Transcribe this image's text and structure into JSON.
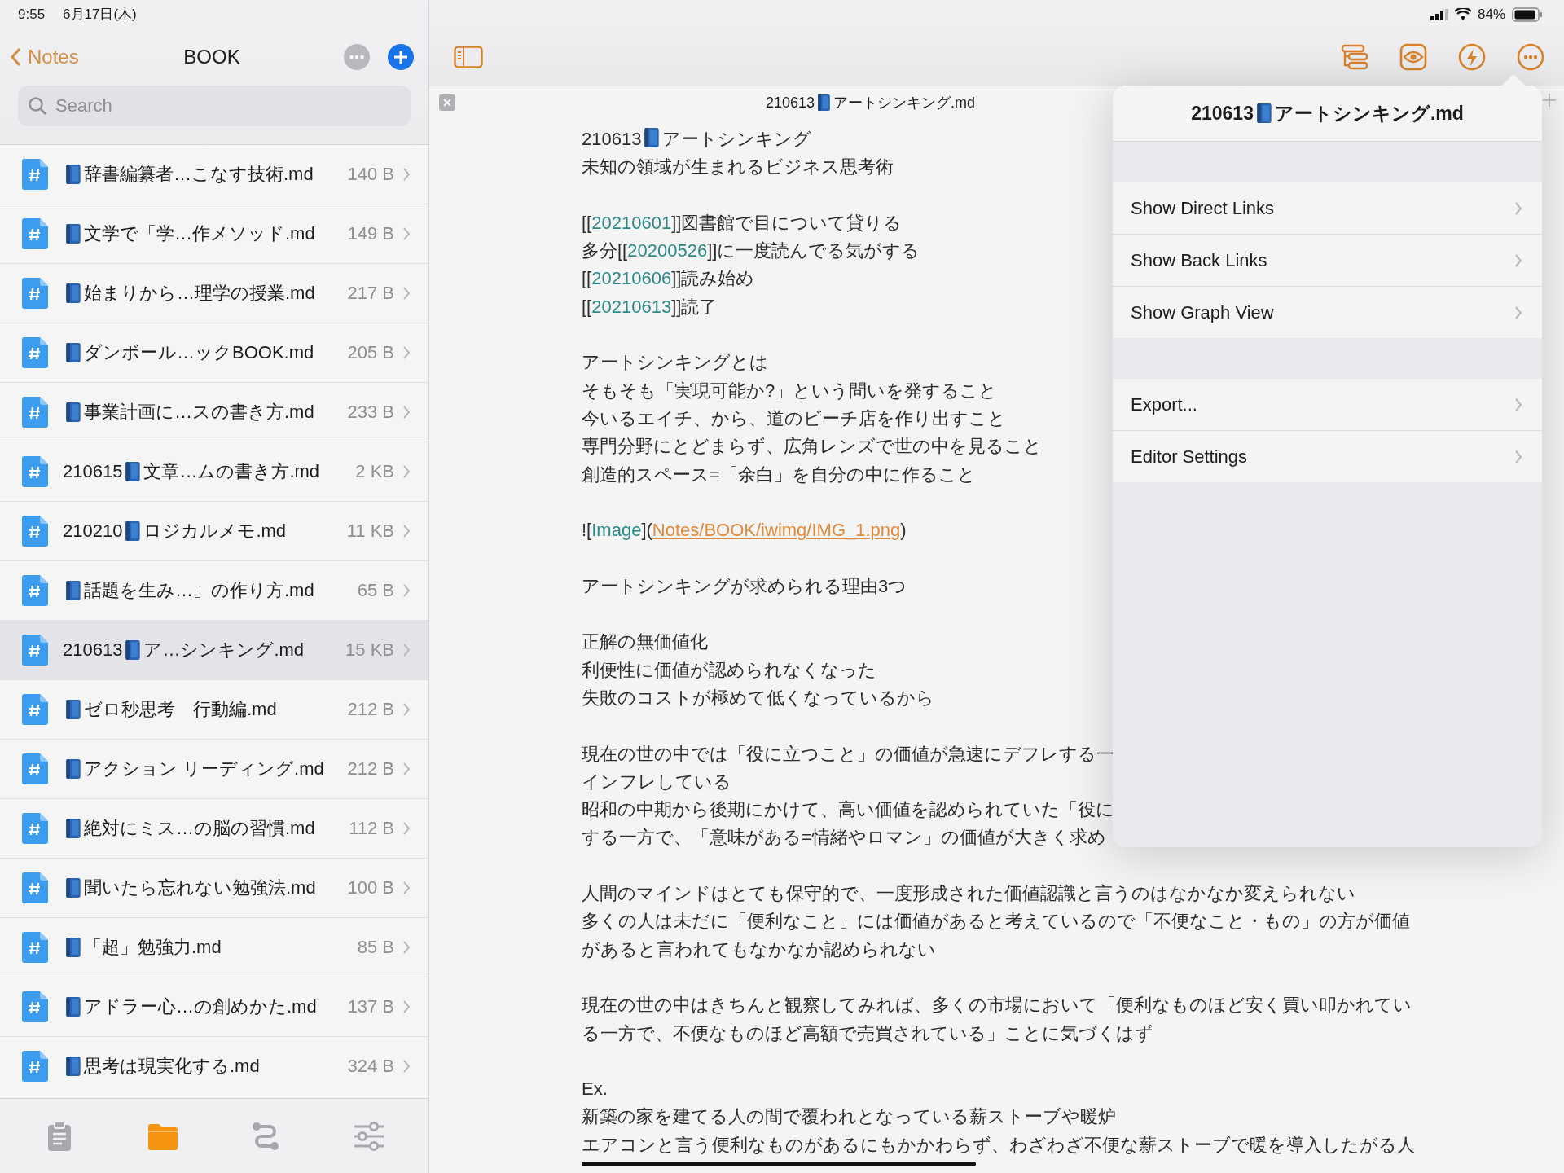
{
  "status_bar": {
    "time": "9:55",
    "date": "6月17日(木)",
    "battery": "84%"
  },
  "sidebar": {
    "back": "Notes",
    "title": "BOOK",
    "search": {
      "placeholder": "Search"
    },
    "files": [
      {
        "title": "辞書編纂者…こなす技術.md",
        "size": "140 B",
        "selected": false
      },
      {
        "title": "文学で「学…作メソッド.md",
        "size": "149 B",
        "selected": false
      },
      {
        "title": "始まりから…理学の授業.md",
        "size": "217 B",
        "selected": false
      },
      {
        "title": "ダンボール…ックBOOK.md",
        "size": "205 B",
        "selected": false
      },
      {
        "title": "事業計画に…スの書き方.md",
        "size": "233 B",
        "selected": false
      },
      {
        "date": "210615",
        "title": "文章…ムの書き方.md",
        "size": "2 KB",
        "selected": false
      },
      {
        "date": "210210",
        "title": "ロジカルメモ.md",
        "size": "11 KB",
        "selected": false
      },
      {
        "title": "話題を生み…」の作り方.md",
        "size": "65 B",
        "selected": false
      },
      {
        "date": "210613",
        "title": "ア…シンキング.md",
        "size": "15 KB",
        "selected": true
      },
      {
        "title": "ゼロ秒思考　行動編.md",
        "size": "212 B",
        "selected": false
      },
      {
        "title": "アクション リーディング.md",
        "size": "212 B",
        "selected": false
      },
      {
        "title": "絶対にミス…の脳の習慣.md",
        "size": "112 B",
        "selected": false
      },
      {
        "title": "聞いたら忘れない勉強法.md",
        "size": "100 B",
        "selected": false
      },
      {
        "title": "「超」勉強力.md",
        "size": "85 B",
        "selected": false
      },
      {
        "title": "アドラー心…の創めかた.md",
        "size": "137 B",
        "selected": false
      },
      {
        "title": "思考は現実化する.md",
        "size": "324 B",
        "selected": false
      }
    ]
  },
  "tab_bar": [
    {
      "selected": false
    },
    {
      "selected": true
    },
    {
      "selected": false
    },
    {
      "selected": false
    }
  ],
  "editor": {
    "file_tab": {
      "date": "210613",
      "title": "アートシンキング.md"
    },
    "paragraphs": [
      [
        [
          {
            "kind": "text",
            "text": "210613"
          },
          {
            "kind": "book"
          },
          {
            "kind": "text",
            "text": "アートシンキング"
          }
        ],
        "未知の領域が生まれるビジネス思考術"
      ],
      [
        [
          {
            "kind": "text",
            "text": "[["
          },
          {
            "kind": "wikilink",
            "text": "20210601"
          },
          {
            "kind": "text",
            "text": "]]図書館で目について貸りる"
          }
        ],
        [
          {
            "kind": "text",
            "text": "多分[["
          },
          {
            "kind": "wikilink",
            "text": "20200526"
          },
          {
            "kind": "text",
            "text": "]]に一度読んでる気がする"
          }
        ],
        [
          {
            "kind": "text",
            "text": "[["
          },
          {
            "kind": "wikilink",
            "text": "20210606"
          },
          {
            "kind": "text",
            "text": "]]読み始め"
          }
        ],
        [
          {
            "kind": "text",
            "text": "[["
          },
          {
            "kind": "wikilink",
            "text": "20210613"
          },
          {
            "kind": "text",
            "text": "]]読了"
          }
        ]
      ],
      [
        "アートシンキングとは",
        "そもそも「実現可能か?」という問いを発すること",
        "今いるエイチ、から、道のビーチ店を作り出すこと",
        "専門分野にとどまらず、広角レンズで世の中を見ること",
        "創造的スペース=「余白」を自分の中に作ること"
      ],
      [
        [
          {
            "kind": "text",
            "text": "!["
          },
          {
            "kind": "wikilink",
            "text": "Image"
          },
          {
            "kind": "text",
            "text": "]("
          },
          {
            "kind": "url",
            "text": "Notes/BOOK/iwimg/IMG_1.png"
          },
          {
            "kind": "text",
            "text": ")"
          }
        ]
      ],
      [
        "アートシンキングが求められる理由3つ"
      ],
      [
        "正解の無価値化",
        "利便性に価値が認められなくなった",
        "失敗のコストが極めて低くなっているから"
      ],
      [
        "現在の世の中では「役に立つこと」の価値が急速にデフレする一",
        "インフレしている",
        "昭和の中期から後期にかけて、高い価値を認められていた「役に",
        "する一方で、「意味がある=情緒やロマン」の価値が大きく求め"
      ],
      [
        "人間のマインドはとても保守的で、一度形成された価値認識と言うのはなかなか変えられない",
        "多くの人は未だに「便利なこと」には価値があると考えているので「不便なこと・もの」の方が価値",
        "があると言われてもなかなか認められない"
      ],
      [
        "現在の世の中はきちんと観察してみれば、多くの市場において「便利なものほど安く買い叩かれてい",
        "る一方で、不便なものほど高額で売買されている」ことに気づくはず"
      ],
      [
        "Ex.",
        "新築の家を建てる人の間で覆われとなっている薪ストーブや暖炉",
        "エアコンと言う便利なものがあるにもかかわらず、わざわざ不便な薪ストーブで暖を導入したがる人"
      ]
    ]
  },
  "menu": {
    "title": {
      "date": "210613",
      "title": "アートシンキング.md"
    },
    "groups": [
      [
        "Show Direct Links",
        "Show Back Links",
        "Show Graph View"
      ],
      [
        "Export...",
        "Editor Settings"
      ]
    ]
  }
}
